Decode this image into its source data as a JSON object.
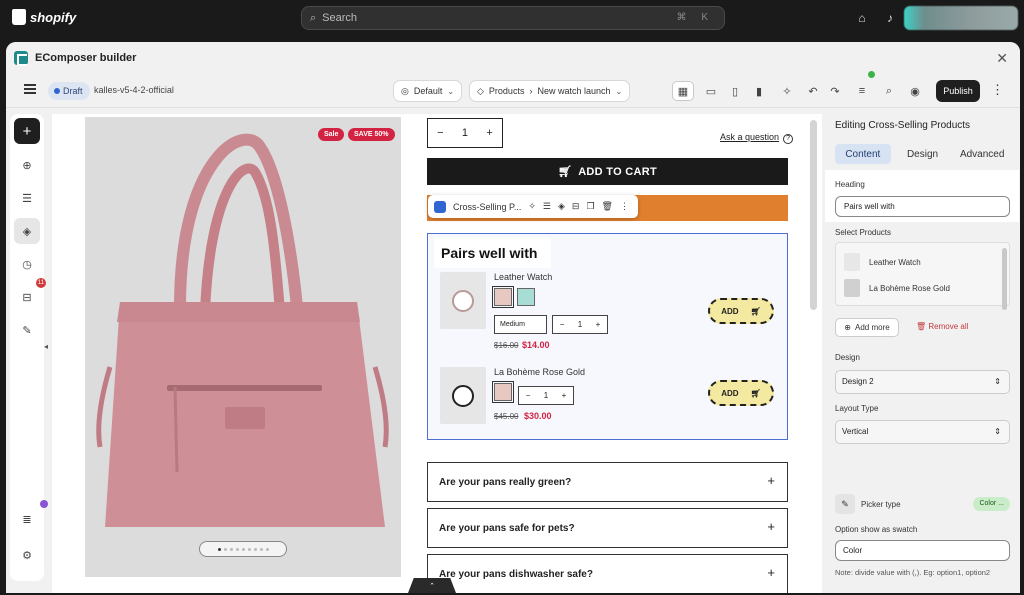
{
  "topbar": {
    "brand": "shopify",
    "search_placeholder": "Search",
    "shortcut": "⌘ K"
  },
  "window": {
    "title": "EComposer builder"
  },
  "toolbar": {
    "status": "Draft",
    "store": "kalles-v5-4-2-official",
    "theme": "Default",
    "breadcrumb_section": "Products",
    "breadcrumb_page": "New watch launch",
    "publish_label": "Publish"
  },
  "sidebar": {
    "notification_count": "11"
  },
  "product": {
    "badges": [
      "Sale",
      "SAVE 50%"
    ],
    "quantity": "1",
    "ask_question": "Ask a question",
    "add_to_cart": "ADD TO CART"
  },
  "element_toolbar": {
    "label": "Cross-Selling P..."
  },
  "cross_sell": {
    "heading": "Pairs well with",
    "products": [
      {
        "name": "Leather Watch",
        "size": "Medium",
        "qty": "1",
        "old_price": "$16.00",
        "price": "$14.00",
        "add": "ADD"
      },
      {
        "name": "La Bohème Rose Gold",
        "qty": "1",
        "old_price": "$45.00",
        "price": "$30.00",
        "add": "ADD"
      }
    ]
  },
  "faqs": [
    "Are your pans really green?",
    "Are your pans safe for pets?",
    "Are your pans dishwasher safe?"
  ],
  "panel": {
    "title": "Editing Cross-Selling Products",
    "tabs": [
      "Content",
      "Design",
      "Advanced"
    ],
    "heading_label": "Heading",
    "heading_value": "Pairs well with",
    "select_products_label": "Select Products",
    "selected_products": [
      "Leather Watch",
      "La Bohème Rose Gold"
    ],
    "add_more": "Add more",
    "remove_all": "Remove all",
    "design_label": "Design",
    "design_value": "Design 2",
    "layout_label": "Layout Type",
    "layout_value": "Vertical",
    "picker_label": "Picker type",
    "picker_value": "Color ...",
    "swatch_label": "Option show as swatch",
    "swatch_value": "Color",
    "note": "Note: divide value with (,). Eg: option1, option2"
  },
  "colors": {
    "accent": "#2f66d0",
    "sale": "#d32342",
    "orange": "#e07f2e",
    "highlight_tab": "#d7e3f3"
  }
}
